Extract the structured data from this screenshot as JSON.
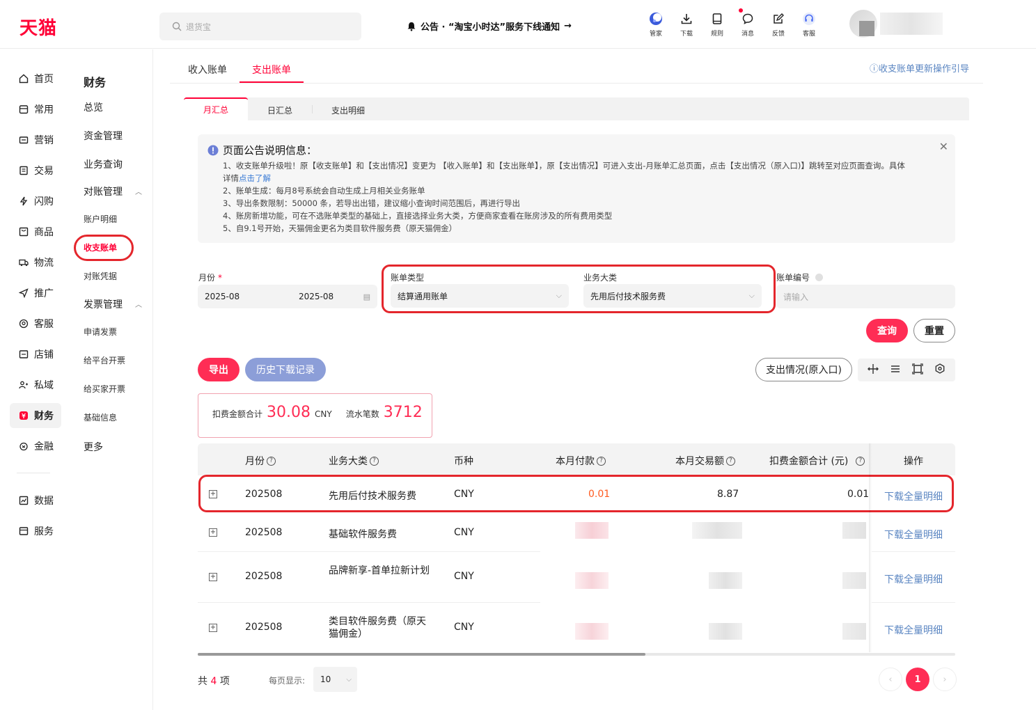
{
  "header": {
    "logo": "天猫",
    "search_placeholder": "退货宝",
    "notice": "公告 · “淘宝小时达”服务下线通知",
    "notice_arrow": "→",
    "icons": [
      {
        "label": "管家",
        "icon": "assistant-icon"
      },
      {
        "label": "下载",
        "icon": "download-icon"
      },
      {
        "label": "规则",
        "icon": "rules-book-icon"
      },
      {
        "label": "消息",
        "icon": "message-icon"
      },
      {
        "label": "反馈",
        "icon": "feedback-icon"
      },
      {
        "label": "客服",
        "icon": "headset-icon"
      }
    ]
  },
  "leftnav": {
    "items": [
      {
        "label": "首页",
        "icon": "home-icon"
      },
      {
        "label": "常用",
        "icon": "frequent-icon"
      },
      {
        "label": "营销",
        "icon": "marketing-icon"
      },
      {
        "label": "交易",
        "icon": "trade-icon"
      },
      {
        "label": "闪购",
        "icon": "flash-icon"
      },
      {
        "label": "商品",
        "icon": "goods-icon"
      },
      {
        "label": "物流",
        "icon": "logistics-icon"
      },
      {
        "label": "推广",
        "icon": "promote-icon"
      },
      {
        "label": "客服",
        "icon": "service-icon"
      },
      {
        "label": "店铺",
        "icon": "store-icon"
      },
      {
        "label": "私域",
        "icon": "private-domain-icon"
      },
      {
        "label": "财务",
        "icon": "finance-icon"
      },
      {
        "label": "金融",
        "icon": "bank-icon"
      }
    ],
    "bottom_items": [
      {
        "label": "数据",
        "icon": "data-icon"
      },
      {
        "label": "服务",
        "icon": "services-icon"
      }
    ]
  },
  "subnav": {
    "title": "财务",
    "items": [
      "总览",
      "资金管理",
      "业务查询",
      "对账管理"
    ],
    "reconcile_children": [
      "账户明细",
      "收支账单",
      "对账凭据"
    ],
    "invoice_group": "发票管理",
    "invoice_children": [
      "申请发票",
      "给平台开票",
      "给买家开票",
      "基础信息"
    ],
    "more": "更多"
  },
  "tabs": {
    "income": "收入账单",
    "expense": "支出账单",
    "guide": "收支账单更新操作引导"
  },
  "subtabs": [
    "月汇总",
    "日汇总",
    "支出明细"
  ],
  "announcement": {
    "title": "页面公告说明信息：",
    "line1": "1、收支账单升级啦！原【收支账单】和【支出情况】变更为 【收入账单】和【支出账单】，原【支出情况】可进入支出-月账单汇总页面，点击【支出情况（原入口)】跳转至对应页面查询。具体",
    "line1b": "详情",
    "link": "点击了解",
    "line2": "2、账单生成：每月8号系统会自动生成上月相关业务账单",
    "line3": "3、导出条数限制：50000 条，若导出出错，建议缩小查询时间范围后，再进行导出",
    "line4": "4、账房新增功能，可在不选账单类型的基础上，直接选择业务大类，方便商家查看在账房涉及的所有费用类型",
    "line5": "5、自9.1号开始，天猫佣金更名为类目软件服务费（原天猫佣金）"
  },
  "filters": {
    "month_label": "月份",
    "month_required": "*",
    "month_start": "2025-08",
    "month_end": "2025-08",
    "bill_type_label": "账单类型",
    "bill_type_value": "结算通用账单",
    "category_label": "业务大类",
    "category_value": "先用后付技术服务费",
    "bill_no_label": "账单编号",
    "bill_no_placeholder": "请输入"
  },
  "actions": {
    "query": "查询",
    "reset": "重置",
    "export": "导出",
    "history": "历史下载记录",
    "old_entry": "支出情况(原入口)"
  },
  "summary": {
    "fee_label": "扣费金额合计",
    "fee_value": "30.08",
    "fee_unit": "CNY",
    "count_label": "流水笔数",
    "count_value": "3712"
  },
  "table": {
    "columns": [
      "月份",
      "业务大类",
      "币种",
      "本月付款",
      "本月交易额",
      "扣费金额合计 (元)",
      "操作"
    ],
    "rows": [
      {
        "month": "202508",
        "category": "先用后付技术服务费",
        "currency": "CNY",
        "pay": "0.01",
        "trade": "8.87",
        "fee": "0.01",
        "op": "下载全量明细"
      },
      {
        "month": "202508",
        "category": "基础软件服务费",
        "currency": "CNY",
        "op": "下载全量明细"
      },
      {
        "month": "202508",
        "category": "品牌新享-首单拉新计划",
        "currency": "CNY",
        "op": "下载全量明细"
      },
      {
        "month": "202508",
        "category": "类目软件服务费（原天猫佣金）",
        "currency": "CNY",
        "op": "下载全量明细"
      }
    ]
  },
  "pagination": {
    "total_prefix": "共",
    "total": "4",
    "total_suffix": "项",
    "per_page_label": "每页显示:",
    "per_page": "10",
    "current": "1"
  },
  "colors": {
    "accent": "#ff0036",
    "button_red": "#ff2d55",
    "link": "#5b86c2",
    "annotation": "#e4262c"
  }
}
